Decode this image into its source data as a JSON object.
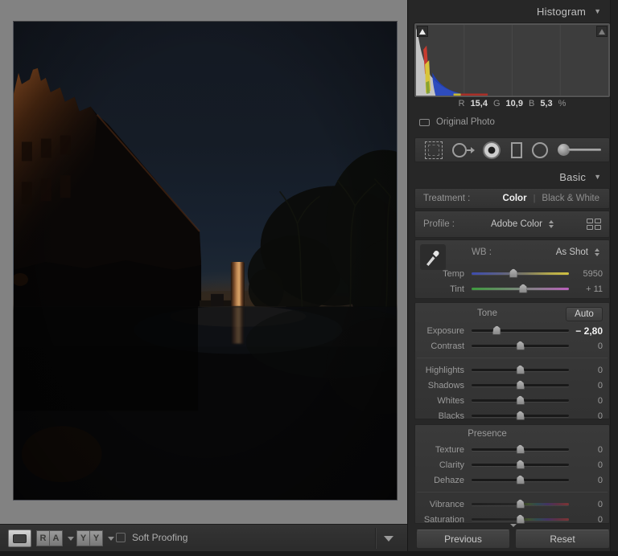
{
  "histogram": {
    "title": "Histogram",
    "collapse_glyph": "▼",
    "readout": [
      {
        "label": "R",
        "value": "15,4"
      },
      {
        "label": "G",
        "value": "10,9"
      },
      {
        "label": "B",
        "value": "5,3"
      }
    ],
    "readout_suffix": "%",
    "original_photo_label": "Original Photo"
  },
  "toolstrip": {
    "icons": [
      "crop-overlay",
      "spot-removal",
      "red-eye-correction",
      "graduated-filter",
      "radial-filter",
      "adjustment-brush"
    ]
  },
  "basic": {
    "title": "Basic",
    "collapse_glyph": "▼",
    "treatment": {
      "label": "Treatment :",
      "color": "Color",
      "divider": "|",
      "black_white": "Black & White"
    },
    "profile": {
      "label": "Profile :",
      "value": "Adobe Color"
    },
    "wb": {
      "label": "WB :",
      "value": "As Shot"
    },
    "temp": {
      "label": "Temp",
      "value": "5950",
      "pos": "43%"
    },
    "tint": {
      "label": "Tint",
      "value": "+ 11",
      "pos": "53%"
    },
    "tone": {
      "header": "Tone",
      "auto_label": "Auto"
    },
    "exposure": {
      "label": "Exposure",
      "value": "− 2,80",
      "pos": "26%"
    },
    "contrast": {
      "label": "Contrast",
      "value": "0",
      "pos": "50%"
    },
    "highlights": {
      "label": "Highlights",
      "value": "0",
      "pos": "50%"
    },
    "shadows": {
      "label": "Shadows",
      "value": "0",
      "pos": "50%"
    },
    "whites": {
      "label": "Whites",
      "value": "0",
      "pos": "50%"
    },
    "blacks": {
      "label": "Blacks",
      "value": "0",
      "pos": "50%"
    },
    "presence": {
      "header": "Presence"
    },
    "texture": {
      "label": "Texture",
      "value": "0",
      "pos": "50%"
    },
    "clarity": {
      "label": "Clarity",
      "value": "0",
      "pos": "50%"
    },
    "dehaze": {
      "label": "Dehaze",
      "value": "0",
      "pos": "50%"
    },
    "vibrance": {
      "label": "Vibrance",
      "value": "0",
      "pos": "50%"
    },
    "saturation": {
      "label": "Saturation",
      "value": "0",
      "pos": "50%"
    }
  },
  "toolbar": {
    "compare_letters": [
      "R",
      "A"
    ],
    "survey_letters": [
      "Y",
      "Y"
    ],
    "soft_proofing_label": "Soft Proofing"
  },
  "footer": {
    "previous": "Previous",
    "reset": "Reset"
  },
  "colors": {
    "accent_warm": "#c08a55",
    "panel_bg": "#272727",
    "content_bg": "#828282"
  }
}
